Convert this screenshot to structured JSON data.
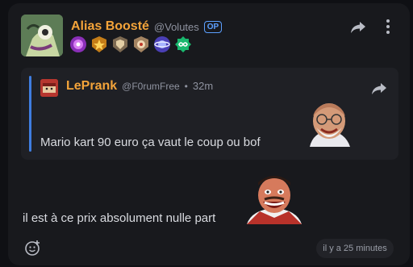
{
  "post": {
    "author_name": "Alias Boosté",
    "author_handle": "@Volutes",
    "op_badge": "OP",
    "badges": [
      {
        "icon": "purple-gem-badge-icon",
        "color": "#b044d8"
      },
      {
        "icon": "gold-star-badge-icon",
        "color": "#e09a2a"
      },
      {
        "icon": "shield-badge-icon",
        "color": "#b58a5a"
      },
      {
        "icon": "flame-badge-icon",
        "color": "#c9a27a"
      },
      {
        "icon": "planet-badge-icon",
        "color": "#6b5bd6"
      },
      {
        "icon": "infinity-badge-icon",
        "color": "#2fd08a"
      }
    ],
    "message": "il est à ce prix absolument nulle part",
    "timestamp": "il y a 25 minutes"
  },
  "quote": {
    "author_name": "LePrank",
    "author_handle": "@F0rumFree",
    "separator": "•",
    "time": "32m",
    "message": "Mario kart 90 euro ça vaut le coup ou bof"
  },
  "icons": {
    "share": "share-arrow-icon",
    "more": "kebab-menu-icon",
    "react": "emoji-reaction-icon"
  },
  "colors": {
    "accent_name": "#f4a43a",
    "op_badge": "#5ca0ff",
    "quote_bar": "#3f7de0"
  }
}
